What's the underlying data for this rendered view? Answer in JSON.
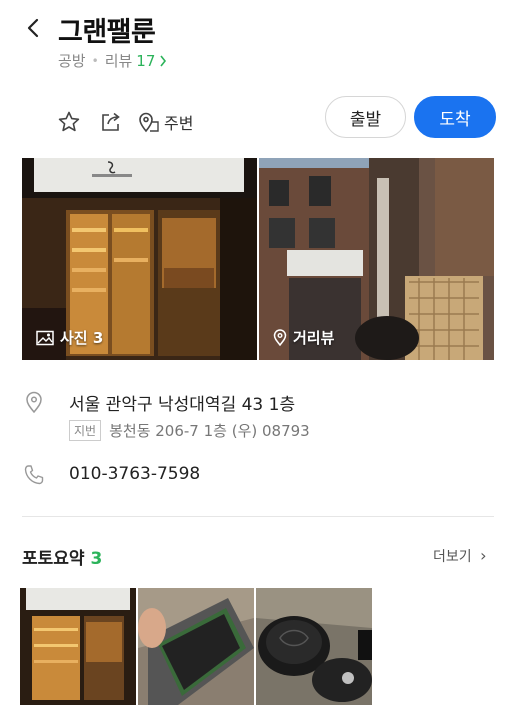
{
  "header": {
    "title": "그랜팰룬",
    "category": "공방",
    "review_label": "리뷰",
    "review_count": "17",
    "icons": [
      "back-arrow-icon",
      "chevron-right-icon"
    ]
  },
  "actions": {
    "around_label": "주변",
    "depart_label": "출발",
    "arrive_label": "도착",
    "icons": [
      "star-icon",
      "share-icon",
      "map-pin-icon"
    ]
  },
  "photos": {
    "photo_label": "사진 3",
    "roadview_label": "거리뷰",
    "icons": [
      "image-icon",
      "pin-icon"
    ]
  },
  "info": {
    "address": "서울 관악구 낙성대역길 43 1층",
    "jibun_tag": "지번",
    "jibun_address": "봉천동 206-7 1층 (우) 08793",
    "phone": "010-3763-7598",
    "icons": [
      "location-icon",
      "phone-icon"
    ]
  },
  "photo_summary": {
    "title": "포토요약",
    "count": "3",
    "more_label": "더보기",
    "more_chevron": "›"
  },
  "colors": {
    "accent_green": "#2bb35a",
    "primary_blue": "#1a73f0"
  }
}
